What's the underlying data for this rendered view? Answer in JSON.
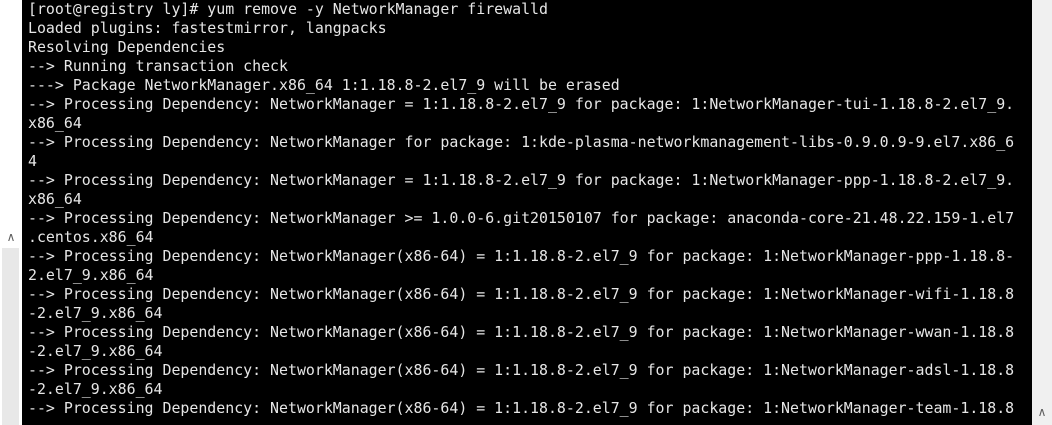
{
  "left_scrollbar": {
    "arrow_icon": "chevron-up-icon",
    "arrow_glyph": "∧"
  },
  "right_scrollbar": {
    "arrow_icon": "chevron-up-icon",
    "arrow_glyph": "∧"
  },
  "terminal": {
    "background": "#000000",
    "foreground": "#e6e6e6",
    "lines": [
      "[root@registry ly]# yum remove -y NetworkManager firewalld",
      "Loaded plugins: fastestmirror, langpacks",
      "Resolving Dependencies",
      "--> Running transaction check",
      "---> Package NetworkManager.x86_64 1:1.18.8-2.el7_9 will be erased",
      "--> Processing Dependency: NetworkManager = 1:1.18.8-2.el7_9 for package: 1:NetworkManager-tui-1.18.8-2.el7_9.",
      "x86_64",
      "--> Processing Dependency: NetworkManager for package: 1:kde-plasma-networkmanagement-libs-0.9.0.9-9.el7.x86_6",
      "4",
      "--> Processing Dependency: NetworkManager = 1:1.18.8-2.el7_9 for package: 1:NetworkManager-ppp-1.18.8-2.el7_9.",
      "x86_64",
      "--> Processing Dependency: NetworkManager >= 1.0.0-6.git20150107 for package: anaconda-core-21.48.22.159-1.el7",
      ".centos.x86_64",
      "--> Processing Dependency: NetworkManager(x86-64) = 1:1.18.8-2.el7_9 for package: 1:NetworkManager-ppp-1.18.8-",
      "2.el7_9.x86_64",
      "--> Processing Dependency: NetworkManager(x86-64) = 1:1.18.8-2.el7_9 for package: 1:NetworkManager-wifi-1.18.8",
      "-2.el7_9.x86_64",
      "--> Processing Dependency: NetworkManager(x86-64) = 1:1.18.8-2.el7_9 for package: 1:NetworkManager-wwan-1.18.8",
      "-2.el7_9.x86_64",
      "--> Processing Dependency: NetworkManager(x86-64) = 1:1.18.8-2.el7_9 for package: 1:NetworkManager-adsl-1.18.8",
      "-2.el7_9.x86_64",
      "--> Processing Dependency: NetworkManager(x86-64) = 1:1.18.8-2.el7_9 for package: 1:NetworkManager-team-1.18.8"
    ]
  }
}
